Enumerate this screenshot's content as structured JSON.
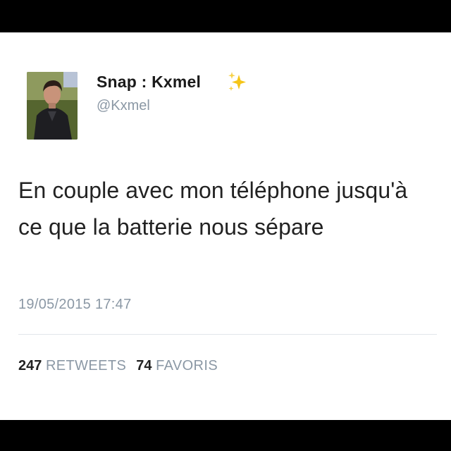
{
  "tweet": {
    "display_name": "Snap : Kxmel",
    "name_emoji_icon": "sparkles-icon",
    "handle": "@Kxmel",
    "text": "En couple avec mon téléphone jusqu'à ce que la batterie nous sépare",
    "timestamp": "19/05/2015 17:47",
    "retweets_count": "247",
    "retweets_label": "RETWEETS",
    "favorites_count": "74",
    "favorites_label": "FAVORIS"
  },
  "colors": {
    "background": "#ffffff",
    "frame": "#000000",
    "name": "#1a1a1a",
    "secondary": "#8b98a5",
    "sparkle": "#f5c518"
  }
}
